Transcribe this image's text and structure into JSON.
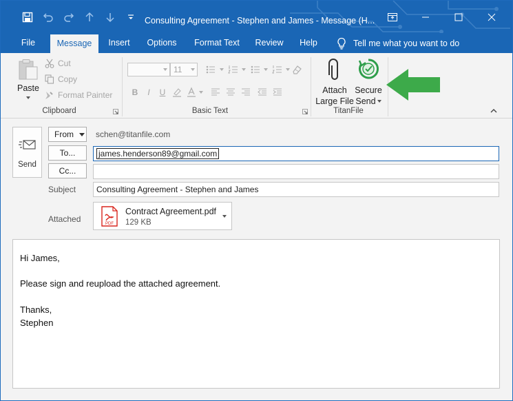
{
  "window": {
    "title": "Consulting Agreement - Stephen and James  -  Message (H...",
    "controls": [
      "restore-ribbon",
      "minimize",
      "maximize",
      "close"
    ]
  },
  "tabs": [
    {
      "label": "File",
      "active": false
    },
    {
      "label": "Message",
      "active": true
    },
    {
      "label": "Insert",
      "active": false
    },
    {
      "label": "Options",
      "active": false
    },
    {
      "label": "Format Text",
      "active": false
    },
    {
      "label": "Review",
      "active": false
    },
    {
      "label": "Help",
      "active": false
    }
  ],
  "tell_me": "Tell me what you want to do",
  "ribbon": {
    "clipboard": {
      "paste": "Paste",
      "cut": "Cut",
      "copy": "Copy",
      "format_painter": "Format Painter",
      "label": "Clipboard"
    },
    "basic_text": {
      "font_size": "11",
      "bold": "B",
      "italic": "I",
      "underline": "U",
      "label": "Basic Text"
    },
    "titanfile": {
      "attach_line1": "Attach",
      "attach_line2": "Large File",
      "secure_line1": "Secure",
      "secure_line2": "Send",
      "label": "TitanFile"
    }
  },
  "compose": {
    "send": "Send",
    "from_button": "From",
    "from_value": "schen@titanfile.com",
    "to_button": "To...",
    "to_value": "james.henderson89@gmail.com",
    "cc_button": "Cc...",
    "cc_value": "",
    "subject_label": "Subject",
    "subject_value": "Consulting Agreement - Stephen and James",
    "attached_label": "Attached",
    "attachment": {
      "name": "Contract Agreement.pdf",
      "size": "129 KB",
      "type_label": "PDF"
    }
  },
  "body": {
    "lines": [
      "Hi James,",
      "Please sign and reupload the attached agreement.",
      "Thanks,",
      "Stephen"
    ]
  },
  "colors": {
    "accent": "#1a66b5",
    "annotation_arrow": "#3daa4a",
    "secure_send_icon": "#2e9e4a",
    "pdf_red": "#d9251d"
  }
}
